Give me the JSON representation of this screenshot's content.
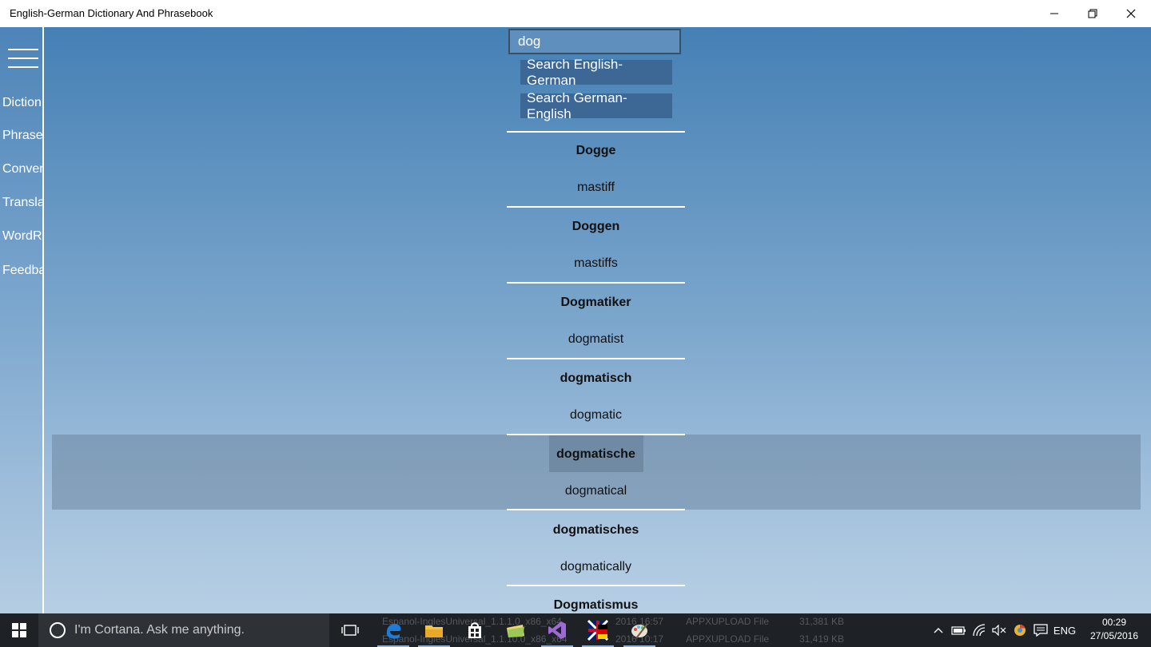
{
  "window": {
    "title": "English-German Dictionary And Phrasebook"
  },
  "nav": {
    "items": [
      {
        "label": "Diction"
      },
      {
        "label": "Phrases"
      },
      {
        "label": "Conver"
      },
      {
        "label": "Transla"
      },
      {
        "label": "WordR"
      },
      {
        "label": "Feedba"
      }
    ]
  },
  "search": {
    "value": "dog",
    "button_en_de": "Search English-German",
    "button_de_en": "Search German-English"
  },
  "results": [
    {
      "german": "Dogge",
      "english": "mastiff"
    },
    {
      "german": "Doggen",
      "english": "mastiffs"
    },
    {
      "german": "Dogmatiker",
      "english": "dogmatist"
    },
    {
      "german": "dogmatisch",
      "english": "dogmatic"
    },
    {
      "german": "dogmatische",
      "english": "dogmatical"
    },
    {
      "german": "dogmatisches",
      "english": "dogmatically"
    },
    {
      "german": "Dogmatismus",
      "english": ""
    }
  ],
  "taskbar": {
    "cortana_placeholder": "I'm Cortana. Ask me anything.",
    "background_rows": [
      {
        "name": "Espanol-InglesUniversal_1.1.1.0_x86_x64",
        "date": "2016 16:57",
        "type": "APPXUPLOAD File",
        "size": "31,381 KB"
      },
      {
        "name": "Espanol-InglesUniversal_1.1.10.0_x86_x64",
        "date": "2016 10:17",
        "type": "APPXUPLOAD File",
        "size": "31,419 KB"
      }
    ],
    "language": "ENG",
    "time": "00:29",
    "date": "27/05/2016"
  }
}
